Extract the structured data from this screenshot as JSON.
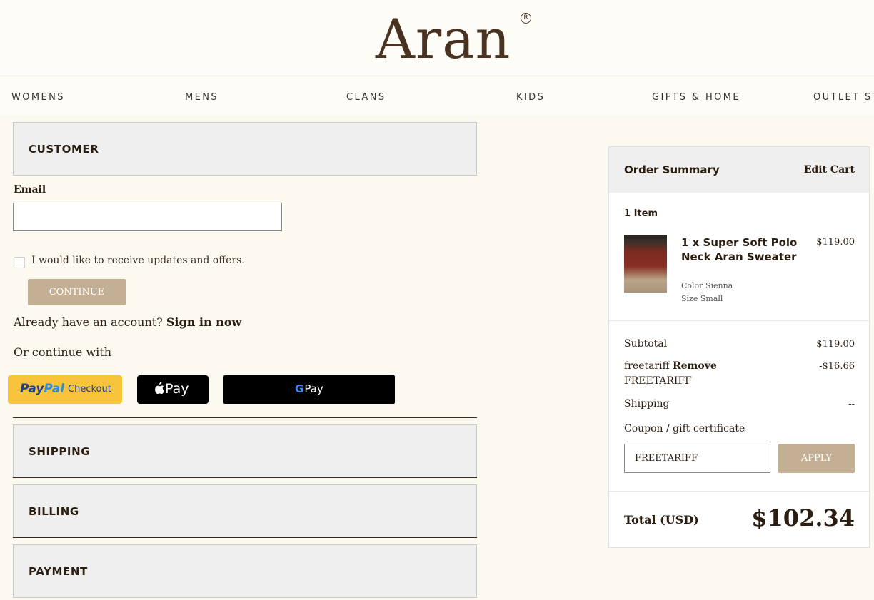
{
  "brand": {
    "logo_text": "Aran",
    "reg_mark": "R"
  },
  "nav": {
    "items": [
      "WOMENS",
      "MENS",
      "CLANS",
      "KIDS",
      "GIFTS & HOME",
      "OUTLET ST"
    ]
  },
  "checkout": {
    "customer_title": "CUSTOMER",
    "email_label": "Email",
    "email_value": "",
    "updates_label": "I would like to receive updates and offers.",
    "continue_label": "CONTINUE",
    "account_prefix": "Already have an account?",
    "signin_label": "Sign in now",
    "continue_with": "Or continue with",
    "paypal": {
      "logo_a": "Pay",
      "logo_b": "Pal",
      "text": "Checkout"
    },
    "applepay": {
      "text": "Pay"
    },
    "gpay": {
      "g": "G",
      "text": "Pay"
    },
    "shipping_title": "SHIPPING",
    "billing_title": "BILLING",
    "payment_title": "PAYMENT"
  },
  "summary": {
    "title": "Order Summary",
    "edit_cart": "Edit Cart",
    "items_count": "1 Item",
    "product": {
      "name": "1 x Super Soft Polo Neck Aran Sweater",
      "price": "$119.00",
      "color": "Color Sienna",
      "size": "Size Small"
    },
    "subtotal_label": "Subtotal",
    "subtotal_value": "$119.00",
    "discount_code": "freetariff",
    "remove_label": "Remove",
    "discount_value": "-$16.66",
    "discount_code_upper": "FREETARIFF",
    "shipping_label": "Shipping",
    "shipping_value": "--",
    "coupon_label": "Coupon / gift certificate",
    "coupon_value": "FREETARIFF",
    "apply_label": "APPLY",
    "total_label": "Total (USD)",
    "total_value": "$102.34"
  }
}
